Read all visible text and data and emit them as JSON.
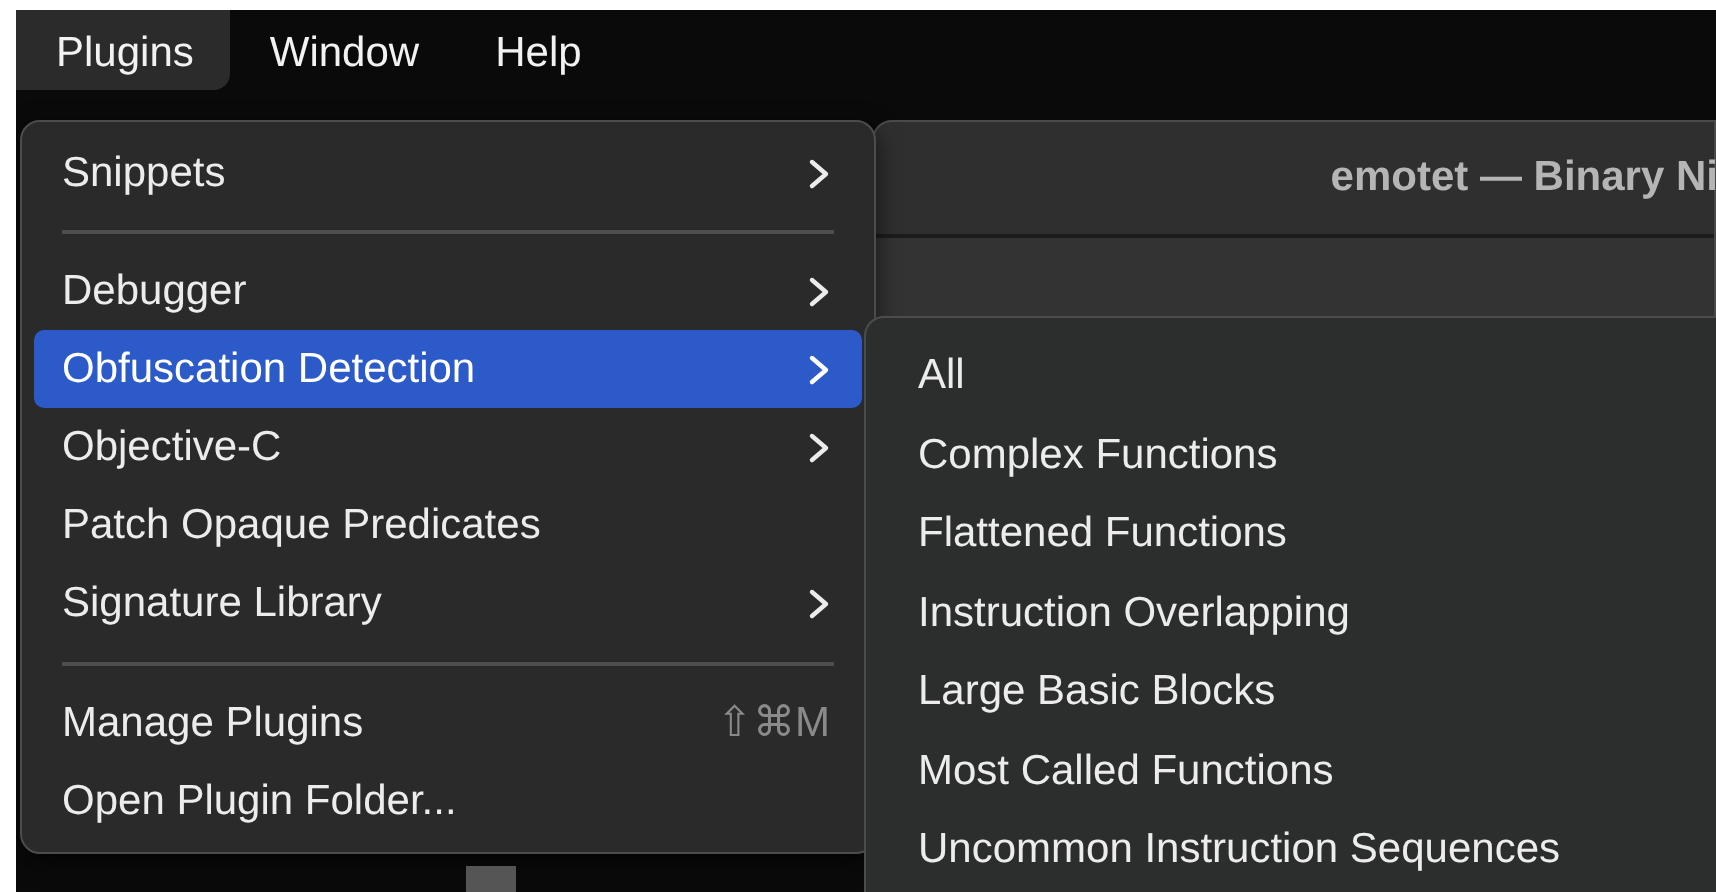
{
  "menubar": [
    {
      "label": "Plugins",
      "selected": true
    },
    {
      "label": "Window",
      "selected": false
    },
    {
      "label": "Help",
      "selected": false
    }
  ],
  "window": {
    "title": "emotet — Binary Ni"
  },
  "menu": [
    {
      "kind": "item",
      "label": "Snippets",
      "submenu": true,
      "selected": false
    },
    {
      "kind": "separator"
    },
    {
      "kind": "item",
      "label": "Debugger",
      "submenu": true,
      "selected": false
    },
    {
      "kind": "item",
      "label": "Obfuscation Detection",
      "submenu": true,
      "selected": true
    },
    {
      "kind": "item",
      "label": "Objective-C",
      "submenu": true,
      "selected": false
    },
    {
      "kind": "item",
      "label": "Patch Opaque Predicates",
      "submenu": false,
      "selected": false
    },
    {
      "kind": "item",
      "label": "Signature Library",
      "submenu": true,
      "selected": false
    },
    {
      "kind": "separator"
    },
    {
      "kind": "item",
      "label": "Manage Plugins",
      "submenu": false,
      "selected": false,
      "shortcut": "⇧⌘M"
    },
    {
      "kind": "item",
      "label": "Open Plugin Folder...",
      "submenu": false,
      "selected": false
    }
  ],
  "submenu": [
    {
      "label": "All"
    },
    {
      "label": "Complex Functions"
    },
    {
      "label": "Flattened Functions"
    },
    {
      "label": "Instruction Overlapping"
    },
    {
      "label": "Large Basic Blocks"
    },
    {
      "label": "Most Called Functions"
    },
    {
      "label": "Uncommon Instruction Sequences"
    }
  ]
}
